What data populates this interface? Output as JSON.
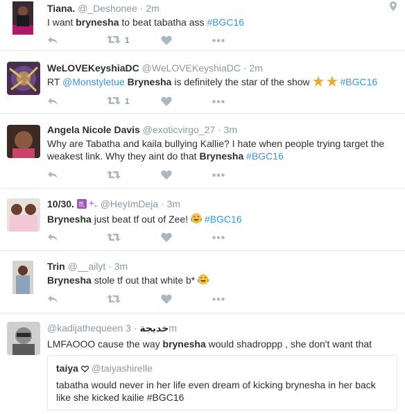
{
  "tweets": [
    {
      "name": "Tiana.",
      "handle": "@_Deshonee",
      "time": "2m",
      "text_parts": [
        "I want ",
        "brynesha",
        " to beat tabatha ass ",
        "#BGC16"
      ],
      "retweets": "1",
      "avatar_icon": "avatar-photo"
    },
    {
      "name": "WeLOVEKeyshiaDC",
      "handle": "@WeLOVEKeyshiaDC",
      "time": "2m",
      "text_parts": [
        "RT ",
        "@Monstyletue",
        " ",
        "Brynesha",
        " is definitely the star of the show ",
        " ",
        "#BGC16"
      ],
      "retweets": "1",
      "avatar_icon": "avatar-photo"
    },
    {
      "name": "Angela Nicole Davis",
      "handle": "@exoticvirgo_27",
      "time": "3m",
      "text_parts": [
        "Why are Tabatha and kaila bullying Kallie? I hate when people trying target the weakest link. Why they aint do that ",
        "Brynesha",
        " ",
        "#BGC16"
      ],
      "avatar_icon": "avatar-photo"
    },
    {
      "name": "10/30.",
      "handle": "@HeyImDeja",
      "time": "3m",
      "text_parts": [
        "Brynesha",
        " just beat tf out of Zee! ",
        " ",
        "#BGC16"
      ],
      "avatar_icon": "avatar-photo"
    },
    {
      "name": "Trin",
      "handle": "@__ailyt",
      "time": "3m",
      "text_parts": [
        "Brynesha",
        " stole tf out that white b* "
      ],
      "avatar_icon": "avatar-photo"
    },
    {
      "name": "",
      "handle": "@kadijathequeen",
      "name_arabic": "خديجة",
      "time": "3m",
      "text_parts": [
        "LMFAOOO cause the way ",
        "brynesha",
        " would shadroppp , she don't want that"
      ],
      "avatar_icon": "avatar-photo",
      "quote": {
        "name": "taiya",
        "handle": "@taiyashirelle",
        "text": "tabatha would never in her life even dream of kicking brynesha in her back like she kicked kailie #BGC16"
      }
    }
  ],
  "separator": "·",
  "icons": {
    "reply": "reply-icon",
    "retweet": "retweet-icon",
    "like": "heart-icon",
    "more": "more-dots-icon",
    "location": "location-pin-icon",
    "verified": "heart-outline-icon"
  },
  "colors": {
    "link": "#3b94d9",
    "muted": "#8899a6",
    "icon": "#aab8c2",
    "text": "#292f33"
  }
}
